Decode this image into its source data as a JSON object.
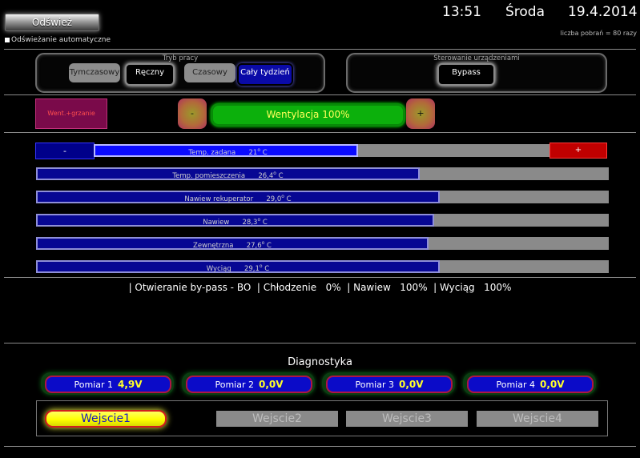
{
  "header": {
    "refresh_label": "Odśwież",
    "auto_refresh_label": "Odświeżanie automatyczne",
    "time": "13:51",
    "day": "Środa",
    "date": "19.4.2014",
    "downloads_label": "liczba pobrań = 80 razy"
  },
  "mode_panel": {
    "title": "Tryb pracy",
    "buttons": [
      "Tymczasowy",
      "Ręczny",
      "Czasowy",
      "Cały tydzień"
    ]
  },
  "device_panel": {
    "title": "Sterowanie urządzeniami",
    "bypass_label": "Bypass"
  },
  "ventilation": {
    "went_grzanie_label": "Went.+grzanie",
    "minus_label": "-",
    "plus_label": "+",
    "label": "Wentylacja  100%"
  },
  "temperatures": {
    "minus_label": "-",
    "plus_label": "+",
    "set": {
      "label": "Temp. zadana",
      "value": "21",
      "unit": "C",
      "level": 0.58
    },
    "rows": [
      {
        "label": "Temp. pomieszczenia",
        "value": "26,4",
        "unit": "C",
        "level": 0.67
      },
      {
        "label": "Nawiew rekuperator",
        "value": "29,0",
        "unit": "C",
        "level": 0.705
      },
      {
        "label": "Nawiew",
        "value": "28,3",
        "unit": "C",
        "level": 0.695
      },
      {
        "label": "Zewnętrzna",
        "value": "27,6",
        "unit": "C",
        "level": 0.685
      },
      {
        "label": "Wyciąg",
        "value": "29,1",
        "unit": "C",
        "level": 0.705
      }
    ]
  },
  "status_line": "| Otwieranie by-pass - BO  | Chłodzenie   0%  | Nawiew   100%  | Wyciąg   100%",
  "diagnostics": {
    "title": "Diagnostyka",
    "pomiary": [
      {
        "label": "Pomiar 1",
        "value": "4,9V"
      },
      {
        "label": "Pomiar 2",
        "value": "0,0V"
      },
      {
        "label": "Pomiar 3",
        "value": "0,0V"
      },
      {
        "label": "Pomiar 4",
        "value": "0,0V"
      }
    ],
    "wejscia": [
      "Wejscie1",
      "Wejscie2",
      "Wejscie3",
      "Wejscie4"
    ]
  },
  "colors": {
    "accent_blue": "#0a0aff",
    "bar_blue": "#070793",
    "went_green": "#0cb00c",
    "plus_red": "#c00000",
    "active_yellow": "#ffff00"
  }
}
